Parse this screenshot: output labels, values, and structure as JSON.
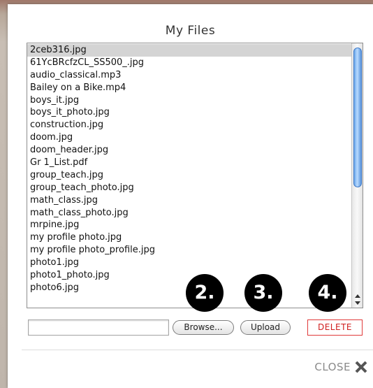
{
  "dialog": {
    "title": "My Files",
    "files": [
      "2ceb316.jpg",
      "61YcBRcfzCL_SS500_.jpg",
      "audio_classical.mp3",
      "Bailey on a Bike.mp4",
      "boys_it.jpg",
      "boys_it_photo.jpg",
      "construction.jpg",
      "doom.jpg",
      "doom_header.jpg",
      "Gr 1_List.pdf",
      "group_teach.jpg",
      "group_teach_photo.jpg",
      "math_class.jpg",
      "math_class_photo.jpg",
      "mrpine.jpg",
      "my profile photo.jpg",
      "my profile photo_profile.jpg",
      "photo1.jpg",
      "photo1_photo.jpg",
      "photo6.jpg"
    ],
    "selected_index": 0,
    "file_input_value": "",
    "browse_label": "Browse...",
    "upload_label": "Upload",
    "delete_label": "DELETE",
    "close_label": "CLOSE",
    "badges": [
      "2.",
      "3.",
      "4."
    ],
    "colors": {
      "delete_red": "#d01e1e",
      "scroll_thumb": "#6aa6ea",
      "badge_bg": "#000000"
    }
  }
}
